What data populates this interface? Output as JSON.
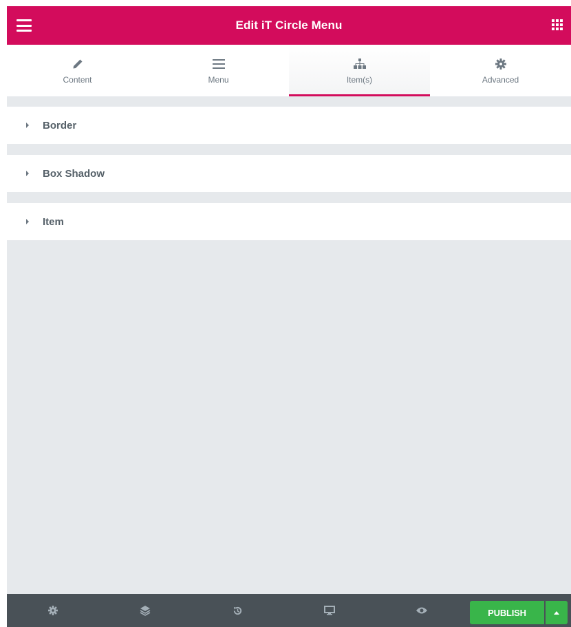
{
  "header": {
    "title": "Edit iT Circle Menu",
    "menu_icon": "hamburger-icon",
    "apps_icon": "grid-icon",
    "color": "#d30c5c"
  },
  "tabs": [
    {
      "label": "Content",
      "icon": "pencil-icon",
      "active": false
    },
    {
      "label": "Menu",
      "icon": "menu-lines-icon",
      "active": false
    },
    {
      "label": "Item(s)",
      "icon": "sitemap-icon",
      "active": true
    },
    {
      "label": "Advanced",
      "icon": "gear-icon",
      "active": false
    }
  ],
  "sections": [
    {
      "label": "Border"
    },
    {
      "label": "Box Shadow"
    },
    {
      "label": "Item"
    }
  ],
  "footer": {
    "icons": [
      "settings-icon",
      "layers-icon",
      "history-icon",
      "responsive-icon",
      "preview-icon"
    ],
    "publish_label": "PUBLISH",
    "publish_color": "#39b54a"
  }
}
